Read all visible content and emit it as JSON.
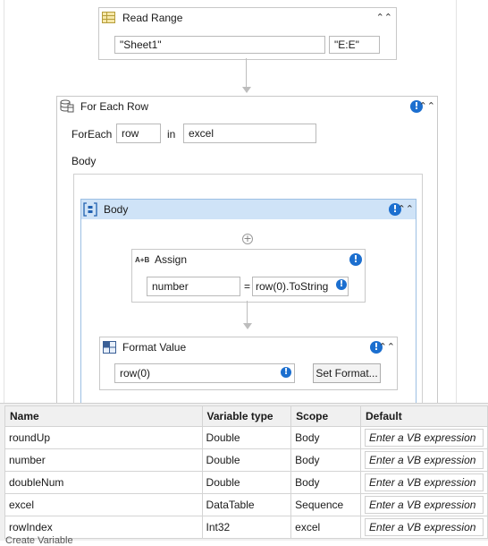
{
  "read_range": {
    "title": "Read Range",
    "icon": "spreadsheet-icon",
    "sheet_value": "\"Sheet1\"",
    "range_value": "\"E:E\""
  },
  "for_each_row": {
    "title": "For Each Row",
    "icon": "datatable-icon",
    "foreach_label": "ForEach",
    "item_value": "row",
    "in_label": "in",
    "collection_value": "excel",
    "body_label": "Body"
  },
  "body_sequence": {
    "title": "Body",
    "icon": "sequence-icon"
  },
  "assign": {
    "title": "Assign",
    "icon_text": "A+B",
    "to_value": "number",
    "equals": "=",
    "value": "row(0).ToString"
  },
  "format_value": {
    "title": "Format Value",
    "icon": "format-icon",
    "input_value": "row(0)",
    "button_label": "Set Format..."
  },
  "warning_glyph": "!",
  "variables": {
    "headers": [
      "Name",
      "Variable type",
      "Scope",
      "Default"
    ],
    "rows": [
      {
        "name": "roundUp",
        "type": "Double",
        "scope": "Body",
        "default": "Enter a VB expression"
      },
      {
        "name": "number",
        "type": "Double",
        "scope": "Body",
        "default": "Enter a VB expression"
      },
      {
        "name": "doubleNum",
        "type": "Double",
        "scope": "Body",
        "default": "Enter a VB expression"
      },
      {
        "name": "excel",
        "type": "DataTable",
        "scope": "Sequence",
        "default": "Enter a VB expression"
      },
      {
        "name": "rowIndex",
        "type": "Int32",
        "scope": "excel",
        "default": "Enter a VB expression"
      }
    ],
    "create_label": "Create Variable"
  },
  "colors": {
    "selected_header": "#cfe3f7",
    "warning": "#1c6fcf"
  }
}
